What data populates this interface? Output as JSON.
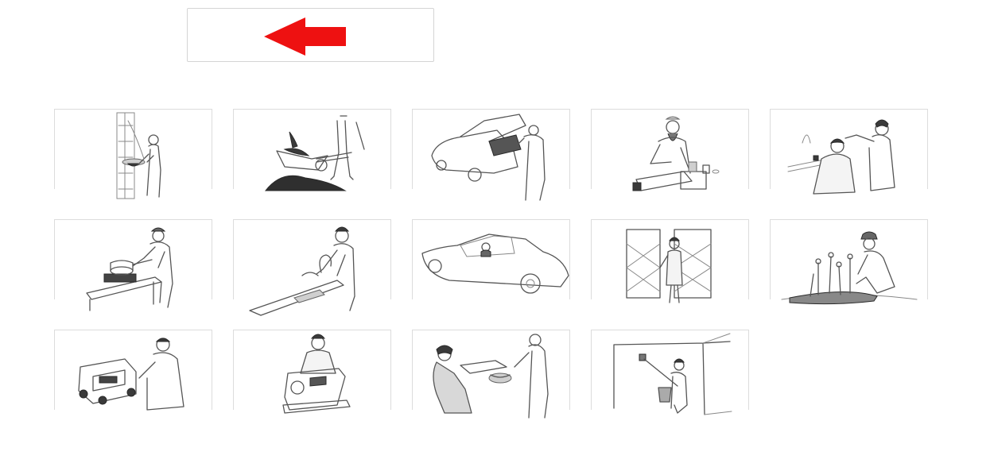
{
  "back_button": {
    "icon": "left-arrow-icon",
    "color": "#ee1111"
  },
  "tiles": [
    {
      "icon": "firewood-worker-icon"
    },
    {
      "icon": "wheelbarrow-worker-icon"
    },
    {
      "icon": "car-mechanic-icon"
    },
    {
      "icon": "shopkeeper-icon"
    },
    {
      "icon": "barber-icon"
    },
    {
      "icon": "cook-icon"
    },
    {
      "icon": "dishwasher-icon"
    },
    {
      "icon": "driver-icon"
    },
    {
      "icon": "gatekeeper-icon"
    },
    {
      "icon": "gardener-icon"
    },
    {
      "icon": "generator-repair-icon"
    },
    {
      "icon": "tailor-icon"
    },
    {
      "icon": "waiter-icon"
    },
    {
      "icon": "wall-painter-icon"
    }
  ]
}
